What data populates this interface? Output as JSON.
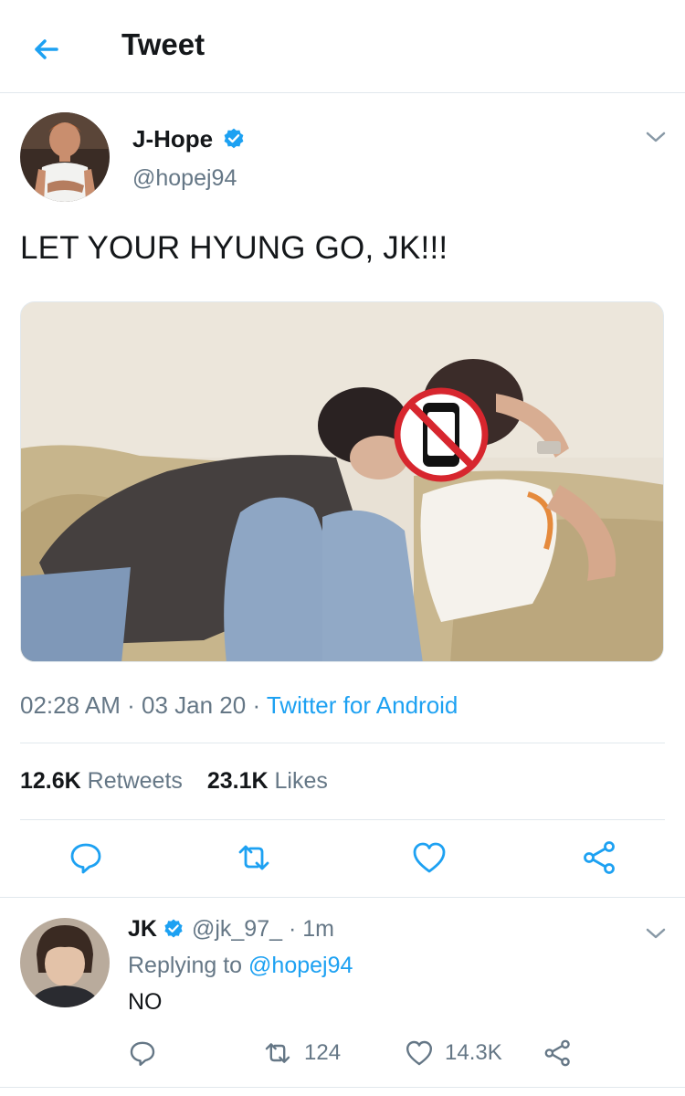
{
  "header": {
    "title": "Tweet"
  },
  "tweet": {
    "author": {
      "name": "J-Hope",
      "handle": "@hopej94"
    },
    "text": "LET YOUR HYUNG GO, JK!!!",
    "time": "02:28 AM",
    "date": "03 Jan 20",
    "source": "Twitter for Android",
    "retweets_count": "12.6K",
    "retweets_label": "Retweets",
    "likes_count": "23.1K",
    "likes_label": "Likes"
  },
  "reply": {
    "author": {
      "name": "JK",
      "handle": "@jk_97_"
    },
    "time": "1m",
    "replying_label": "Replying to",
    "replying_to": "@hopej94",
    "text": "NO",
    "retweets": "124",
    "likes": "14.3K"
  },
  "colors": {
    "accent": "#1da1f2",
    "muted": "#657786",
    "text": "#14171a",
    "border": "#e1e8ed",
    "no_sign": "#d7262e"
  },
  "icons": [
    "back-arrow-icon",
    "verified-badge-icon",
    "chevron-down-icon",
    "reply-icon",
    "retweet-icon",
    "like-icon",
    "share-icon",
    "no-phone-icon"
  ]
}
